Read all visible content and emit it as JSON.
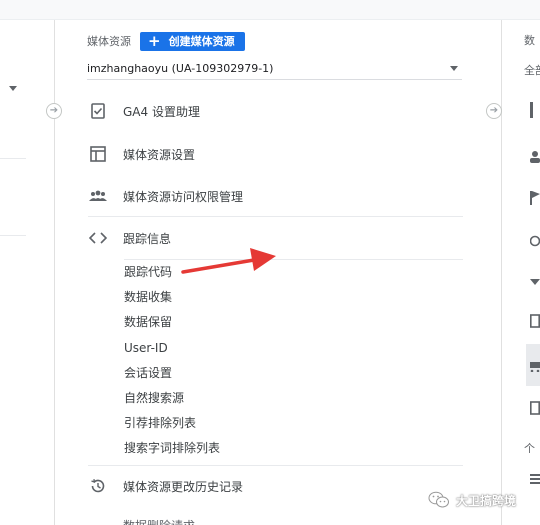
{
  "left_column": {
    "visible": true
  },
  "property": {
    "label": "媒体资源",
    "create_button": {
      "icon": "plus-icon",
      "label": "创建媒体资源"
    },
    "selected": "imzhanghaoyu (UA-109302979-1)"
  },
  "menu": {
    "ga4_assistant": {
      "icon": "checkbox-clipboard-icon",
      "label": "GA4 设置助理"
    },
    "property_settings": {
      "icon": "window-layout-icon",
      "label": "媒体资源设置"
    },
    "access_management": {
      "icon": "people-group-icon",
      "label": "媒体资源访问权限管理"
    },
    "tracking_info": {
      "icon": "code-brackets-icon",
      "label": "跟踪信息"
    },
    "change_history": {
      "icon": "history-icon",
      "label": "媒体资源更改历史记录"
    },
    "next_partial": {
      "label": "数据删除请求"
    }
  },
  "tracking_sub_items": [
    "跟踪代码",
    "数据收集",
    "数据保留",
    "User-ID",
    "会话设置",
    "自然搜索源",
    "引荐排除列表",
    "搜索字词排除列表"
  ],
  "right_column": {
    "header_partial": "数",
    "select_partial": "全部",
    "bottom_partial": "个"
  },
  "watermark": {
    "text": "大卫搞跨境"
  },
  "colors": {
    "primary": "#1a73e8",
    "arrow": "#e53935",
    "text": "#3c4043"
  }
}
